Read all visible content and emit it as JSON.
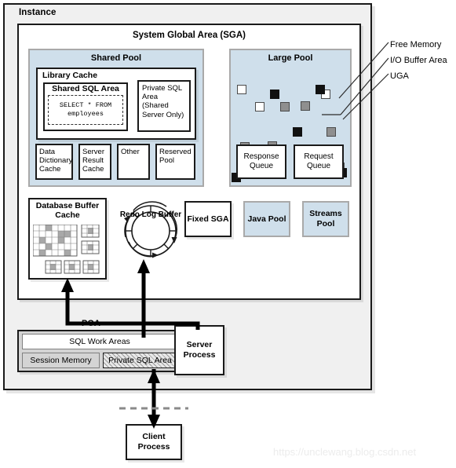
{
  "diagram": {
    "instance_label": "Instance",
    "sga_title": "System Global Area (SGA)"
  },
  "shared_pool": {
    "title": "Shared Pool",
    "library_cache": {
      "title": "Library Cache",
      "shared_sql_area": {
        "title": "Shared SQL Area",
        "sql_line1": "SELECT * FROM",
        "sql_line2": "employees"
      },
      "private_sql_area": "Private SQL Area (Shared Server Only)"
    },
    "sub_boxes": [
      {
        "label": "Data Dictionary Cache"
      },
      {
        "label": "Server Result Cache"
      },
      {
        "label": "Other"
      },
      {
        "label": "Reserved Pool"
      }
    ]
  },
  "large_pool": {
    "title": "Large Pool",
    "queues": [
      {
        "label": "Response Queue"
      },
      {
        "label": "Request Queue"
      }
    ],
    "legend": [
      {
        "label": "Free Memory",
        "type": "free",
        "color": "#ffffff"
      },
      {
        "label": "I/O Buffer Area",
        "type": "io",
        "color": "#8f8f8f"
      },
      {
        "label": "UGA",
        "type": "uga",
        "color": "#111111"
      }
    ]
  },
  "sga_components": {
    "database_buffer_cache": "Database Buffer Cache",
    "redo_log_buffer": "Redo Log Buffer",
    "fixed_sga": "Fixed SGA",
    "java_pool": "Java Pool",
    "streams_pool": "Streams Pool"
  },
  "pga": {
    "title": "PGA",
    "sql_work_areas": "SQL Work Areas",
    "session_memory": "Session Memory",
    "private_sql_area": "Private SQL Area",
    "server_process": "Server Process"
  },
  "client": {
    "client_process": "Client Process"
  },
  "watermark": "https://unclewang.blog.csdn.net",
  "colors": {
    "pool_fill": "#cfdfeb",
    "pool_border": "#a9a9a9",
    "instance_fill": "#f0f0f0",
    "line": "#1a1a1a"
  }
}
